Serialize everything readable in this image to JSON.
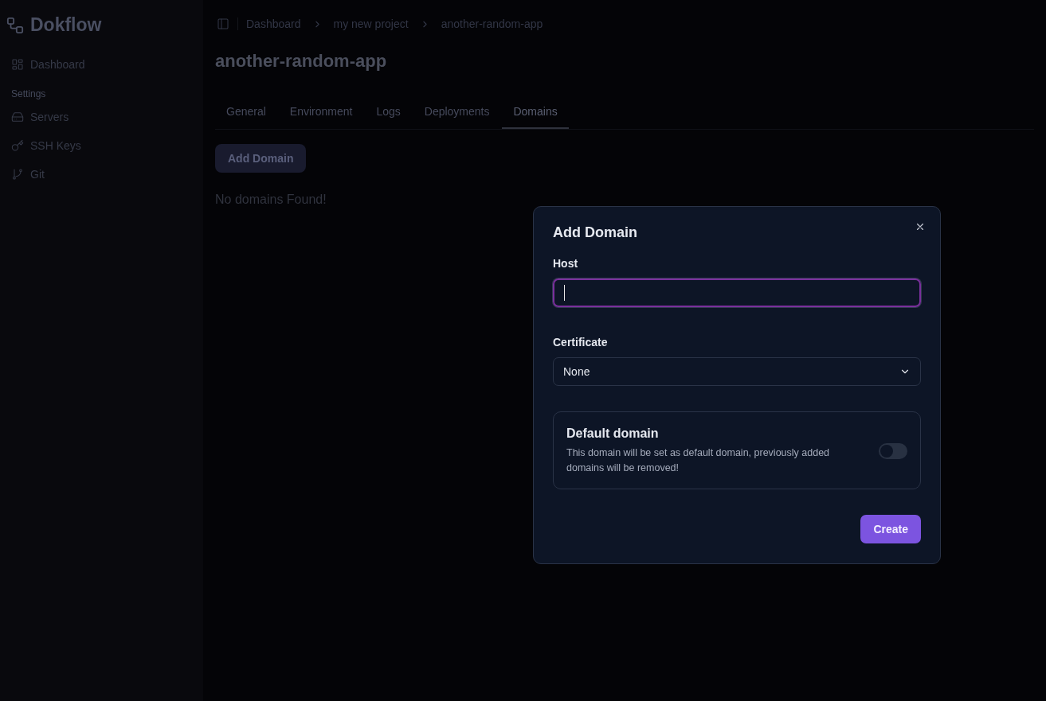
{
  "sidebar": {
    "brand": "Dokflow",
    "items": [
      {
        "kind": "dashboard",
        "label": "Dashboard"
      },
      {
        "kind": "heading",
        "label": "Settings"
      },
      {
        "kind": "servers",
        "label": "Servers"
      },
      {
        "kind": "keys",
        "label": "SSH Keys"
      },
      {
        "kind": "git",
        "label": "Git"
      }
    ]
  },
  "breadcrumb": [
    "Dashboard",
    "my new project",
    "another-random-app"
  ],
  "page_title": "another-random-app",
  "tabs": [
    {
      "label": "General",
      "selected": false
    },
    {
      "label": "Environment",
      "selected": false
    },
    {
      "label": "Logs",
      "selected": false
    },
    {
      "label": "Deployments",
      "selected": false
    },
    {
      "label": "Domains",
      "selected": true
    }
  ],
  "add_button": "Add Domain",
  "empty_message": "No domains Found!",
  "dialog": {
    "title": "Add Domain",
    "host": {
      "label": "Host",
      "focused": true
    },
    "certificate": {
      "label": "Certificate",
      "value": "None"
    },
    "default_domain": {
      "title": "Default domain",
      "description": "This domain will be set as default domain, previously added domains will be removed!",
      "on": false
    },
    "submit": "Create"
  }
}
